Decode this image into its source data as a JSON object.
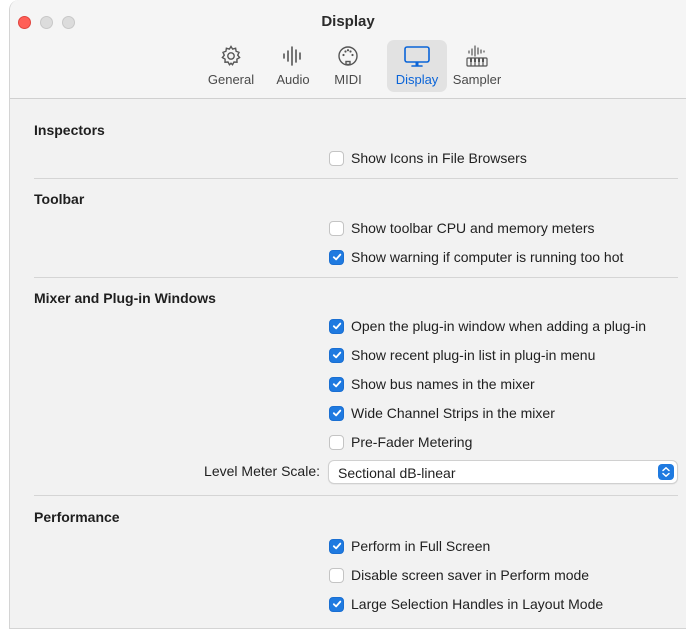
{
  "window": {
    "title": "Display"
  },
  "toolbar": {
    "tabs": [
      {
        "label": "General",
        "icon": "gear-icon"
      },
      {
        "label": "Audio",
        "icon": "waveform-icon"
      },
      {
        "label": "MIDI",
        "icon": "midi-port-icon"
      },
      {
        "label": "Display",
        "icon": "monitor-icon",
        "selected": true
      },
      {
        "label": "Sampler",
        "icon": "sampler-keyboard-icon"
      }
    ]
  },
  "sections": {
    "inspectors": {
      "title": "Inspectors",
      "options": [
        {
          "label": "Show Icons in File Browsers",
          "checked": false
        }
      ]
    },
    "toolbar": {
      "title": "Toolbar",
      "options": [
        {
          "label": "Show toolbar CPU and memory meters",
          "checked": false
        },
        {
          "label": "Show warning if computer is running too hot",
          "checked": true
        }
      ]
    },
    "mixer": {
      "title": "Mixer and Plug-in Windows",
      "options": [
        {
          "label": "Open the plug-in window when adding a plug-in",
          "checked": true
        },
        {
          "label": "Show recent plug-in list in plug-in menu",
          "checked": true
        },
        {
          "label": "Show bus names in the mixer",
          "checked": true
        },
        {
          "label": "Wide Channel Strips in the mixer",
          "checked": true
        },
        {
          "label": "Pre-Fader Metering",
          "checked": false
        }
      ],
      "level_meter": {
        "label": "Level Meter Scale:",
        "value": "Sectional dB-linear"
      }
    },
    "performance": {
      "title": "Performance",
      "options": [
        {
          "label": "Perform in Full Screen",
          "checked": true
        },
        {
          "label": "Disable screen saver in Perform mode",
          "checked": false
        },
        {
          "label": "Large Selection Handles in Layout Mode",
          "checked": true
        }
      ]
    }
  },
  "colors": {
    "accent": "#1f7ae0",
    "close": "#ff5f57"
  }
}
